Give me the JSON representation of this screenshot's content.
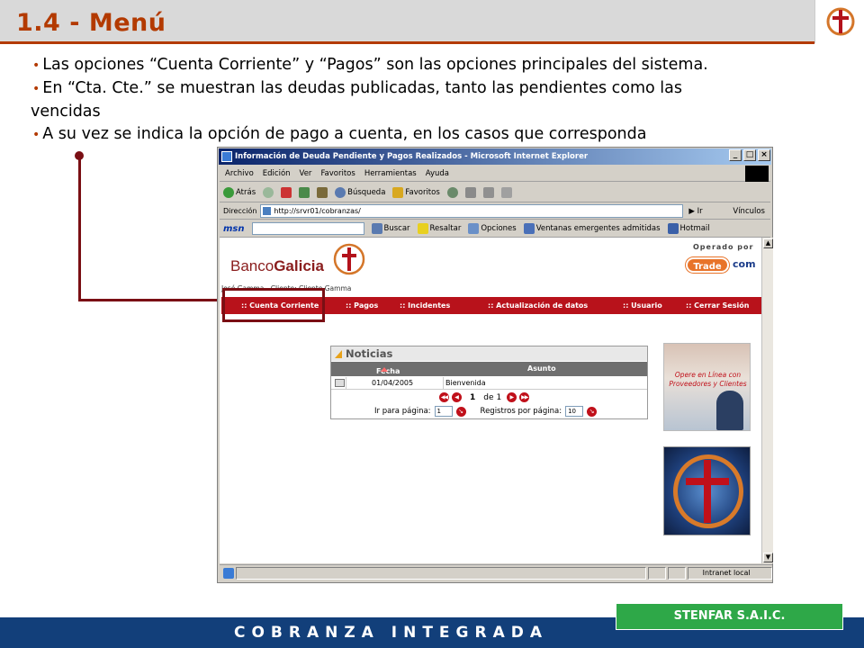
{
  "slide": {
    "title": "1.4 - Menú",
    "bullets": [
      "Las opciones “Cuenta Corriente” y “Pagos” son las opciones principales del sistema.",
      "En “Cta. Cte.” se muestran las deudas publicadas, tanto las pendientes como las",
      "vencidas",
      "A su vez se indica la opción de pago a cuenta, en los casos que corresponda"
    ],
    "footer": "COBRANZA INTEGRADA",
    "company": "STENFAR S.A.I.C.",
    "accent_color": "#b33a00",
    "connector_color": "#7a0f14",
    "footer_color": "#123f7a",
    "company_badge_color": "#2ea848"
  },
  "browser": {
    "window_title": "Información de Deuda Pendiente y Pagos Realizados - Microsoft Internet Explorer",
    "menu": [
      "Archivo",
      "Edición",
      "Ver",
      "Favoritos",
      "Herramientas",
      "Ayuda"
    ],
    "toolbar": {
      "back": "Atrás",
      "search": "Búsqueda",
      "favorites": "Favoritos"
    },
    "address_label": "Dirección",
    "address_value": "http://srvr01/cobranzas/",
    "go_label": "Ir",
    "links_label": "Vínculos",
    "msn": {
      "logo": "msn",
      "search": "Buscar",
      "highlight": "Resaltar",
      "options": "Opciones",
      "popups": "Ventanas emergentes admitidas",
      "hotmail": "Hotmail"
    },
    "status_zone": "Intranet local"
  },
  "site": {
    "brand_prefix": "Banco",
    "brand_name": "Galicia",
    "operated_by": "Operado por",
    "partner_trade": "Trade",
    "partner_com": "com",
    "user_line": "José Gamma - Cliente: Cliente Gamma",
    "nav": [
      ":: Cuenta Corriente",
      ":: Pagos",
      ":: Incidentes",
      ":: Actualización de datos",
      ":: Usuario",
      ":: Cerrar Sesión"
    ],
    "news": {
      "title": "Noticias",
      "col_date": "Fecha",
      "col_subject": "Asunto",
      "rows": [
        {
          "date": "01/04/2005",
          "subject": "Bienvenida"
        }
      ],
      "page_current": "1",
      "page_of": "de",
      "page_total": "1",
      "goto_label": "Ir para página:",
      "goto_value": "1",
      "per_page_label": "Registros por página:",
      "per_page_value": "10"
    },
    "ad_text": "Opere en Línea con Proveedores y Clientes"
  }
}
